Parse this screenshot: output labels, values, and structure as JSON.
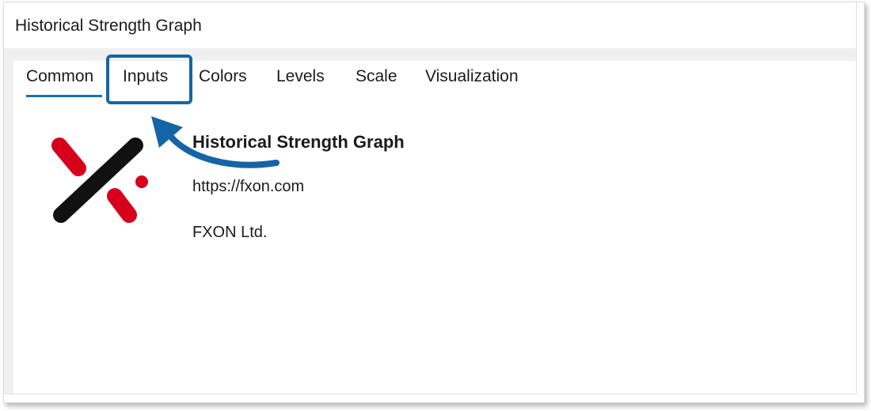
{
  "window": {
    "title": "Historical Strength Graph"
  },
  "tabs": [
    {
      "label": "Common",
      "active": true
    },
    {
      "label": "Inputs",
      "active": false,
      "highlighted": true
    },
    {
      "label": "Colors",
      "active": false
    },
    {
      "label": "Levels",
      "active": false
    },
    {
      "label": "Scale",
      "active": false
    },
    {
      "label": "Visualization",
      "active": false
    }
  ],
  "indicator": {
    "name": "Historical Strength Graph",
    "url": "https://fxon.com",
    "company": "FXON Ltd.",
    "logo_icon": "fxon-logo-icon"
  },
  "colors": {
    "accent": "#1a6fb5",
    "highlight_box": "#1565a6",
    "logo_red": "#d7001a",
    "logo_black": "#111111"
  }
}
